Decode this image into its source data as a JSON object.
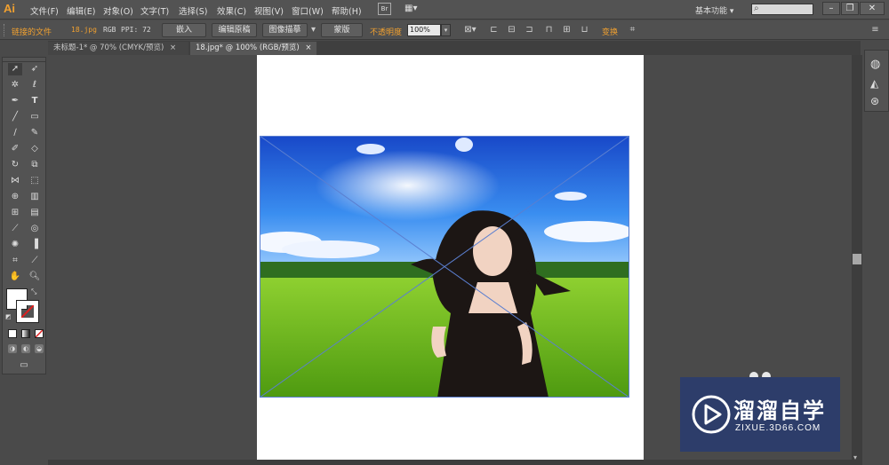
{
  "app": {
    "logo": "Ai"
  },
  "menu": {
    "items": [
      "文件(F)",
      "编辑(E)",
      "对象(O)",
      "文字(T)",
      "选择(S)",
      "效果(C)",
      "视图(V)",
      "窗口(W)",
      "帮助(H)"
    ],
    "bridge": "Br",
    "workspace": "基本功能",
    "search_placeholder": ""
  },
  "controlbar": {
    "linked_file_label": "链接的文件",
    "file_name": "18.jpg",
    "color_mode": "RGB",
    "ppi": "PPI: 72",
    "embed_button": "嵌入",
    "edit_original_button": "编辑原稿",
    "image_trace_button": "图像描摹",
    "mask_button": "蒙版",
    "opacity_label": "不透明度",
    "opacity_value": "100%",
    "transform_link": "变换"
  },
  "tabs": [
    {
      "label": "未标题-1* @ 70% (CMYK/预览)",
      "close": "×"
    },
    {
      "label": "18.jpg* @ 100% (RGB/预览)",
      "close": "×"
    }
  ],
  "watermark": {
    "title": "溜溜自学",
    "url": "ZIXUE.3D66.COM"
  },
  "colors": {
    "accent": "#f0a030",
    "menubar_bg": "#535353",
    "canvas_bg": "#4a4a4a",
    "watermark_bg": "#2d3d6a"
  }
}
